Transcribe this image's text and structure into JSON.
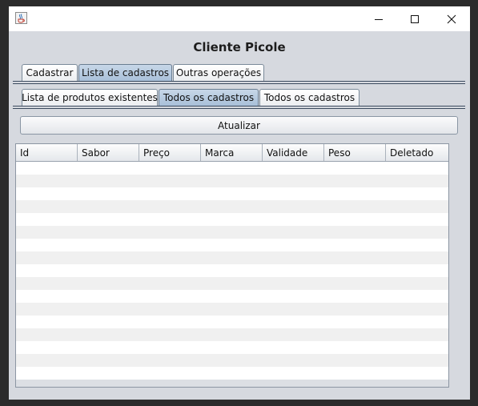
{
  "window": {
    "icon": "java-coffee-icon",
    "controls": [
      "minimize-icon",
      "maximize-icon",
      "close-icon"
    ]
  },
  "form": {
    "title": "Cliente Picole"
  },
  "main_tabs": [
    {
      "label": "Cadastrar",
      "selected": false
    },
    {
      "label": "Lista de cadastros",
      "selected": true
    },
    {
      "label": "Outras operações",
      "selected": false
    }
  ],
  "sub_tabs": [
    {
      "label": "Lista de produtos existentes",
      "selected": false
    },
    {
      "label": "Todos os cadastros",
      "selected": true
    },
    {
      "label": "Todos os cadastros",
      "selected": false
    }
  ],
  "refresh_button": {
    "label": "Atualizar"
  },
  "table": {
    "columns": [
      "Id",
      "Sabor",
      "Preço",
      "Marca",
      "Validade",
      "Peso",
      "Deletado"
    ],
    "rows": []
  },
  "colors": {
    "selected_tab": "#a9c0d9",
    "window_bg": "#d6d9df",
    "stripe": "#f0f0f0"
  }
}
